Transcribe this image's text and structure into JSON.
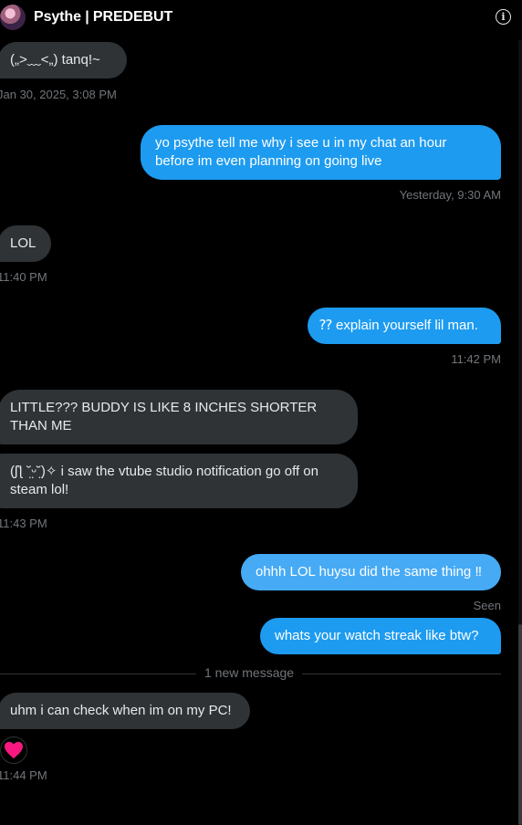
{
  "header": {
    "title": "Psythe | PREDEBUT",
    "info_icon": "info-icon"
  },
  "messages": [
    {
      "id": "m1",
      "side": "received",
      "text": "(„>﹏<„) tanq!~"
    },
    {
      "id": "m2",
      "side": "sent",
      "text": "yo psythe tell me why i see u in my chat an hour before im even planning on going live"
    },
    {
      "id": "m3",
      "side": "received",
      "text": "LOL"
    },
    {
      "id": "m4",
      "side": "sent",
      "text": "⁇ explain yourself lil man."
    },
    {
      "id": "m5",
      "side": "received",
      "text": "LITTLE??? BUDDY IS LIKE 8 INCHES SHORTER THAN ME"
    },
    {
      "id": "m6",
      "side": "received",
      "text": "(ʃƪ ˘̤ᵕ˘̤)✧ i saw the vtube studio notification go off on steam lol!"
    },
    {
      "id": "m7",
      "side": "sent",
      "text": "ohhh LOL huysu did the same thing ‼"
    },
    {
      "id": "m8",
      "side": "sent",
      "text": "whats your watch streak like btw?"
    },
    {
      "id": "m9",
      "side": "received",
      "text": "uhm i can check when im on my PC!"
    }
  ],
  "timestamps": {
    "t1": "Jan 30, 2025, 3:08 PM",
    "t2": "Yesterday, 9:30 AM",
    "t3": "11:40 PM",
    "t4": "11:42 PM",
    "t5": "11:43 PM",
    "seen": "Seen",
    "t6": "11:44 PM"
  },
  "divider": {
    "label": "1 new message"
  },
  "reaction": {
    "emoji": "heart-icon",
    "color": "#f91880"
  },
  "colors": {
    "sent_bubble": "#1d9bf0",
    "received_bubble": "#2f3336",
    "meta_text": "#71767b"
  }
}
